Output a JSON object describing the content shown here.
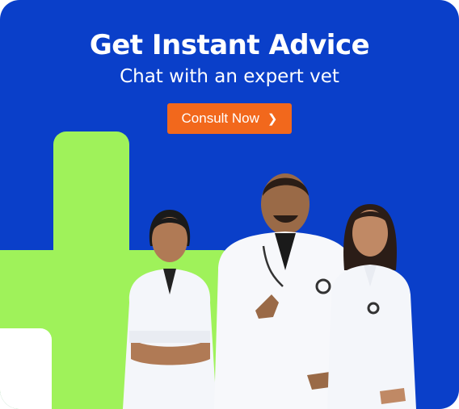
{
  "banner": {
    "title": "Get Instant Advice",
    "subtitle": "Chat with an expert vet",
    "cta_label": "Consult Now",
    "cta_icon": "chevron-right-icon"
  },
  "colors": {
    "background": "#0a3fc9",
    "accent_green": "#9ff25a",
    "cta_orange": "#f2681c",
    "text": "#ffffff"
  }
}
